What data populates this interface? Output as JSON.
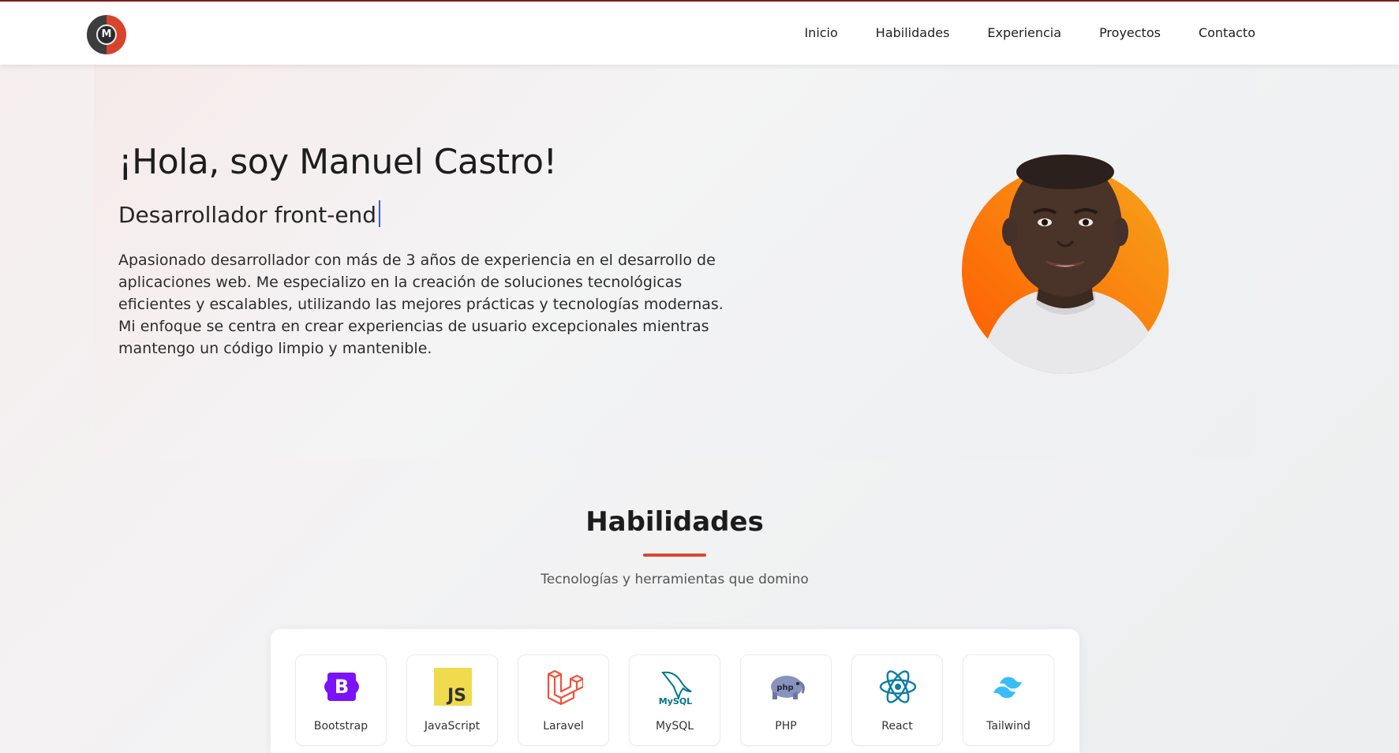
{
  "header": {
    "logo_text": "M",
    "nav": [
      {
        "label": "Inicio"
      },
      {
        "label": "Habilidades"
      },
      {
        "label": "Experiencia"
      },
      {
        "label": "Proyectos"
      },
      {
        "label": "Contacto"
      }
    ]
  },
  "hero": {
    "title": "¡Hola, soy Manuel Castro!",
    "subtitle": "Desarrollador front-end",
    "description": "Apasionado desarrollador con más de 3 años de experiencia en el desarrollo de aplicaciones web. Me especializo en la creación de soluciones tecnológicas eficientes y escalables, utilizando las mejores prácticas y tecnologías modernas. Mi enfoque se centra en crear experiencias de usuario excepcionales mientras mantengo un código limpio y mantenible."
  },
  "skills": {
    "title": "Habilidades",
    "subtitle": "Tecnologías y herramientas que domino",
    "items": [
      {
        "label": "Bootstrap",
        "icon": "bootstrap-icon",
        "icon_text": "B"
      },
      {
        "label": "JavaScript",
        "icon": "javascript-icon",
        "icon_text": "JS"
      },
      {
        "label": "Laravel",
        "icon": "laravel-icon"
      },
      {
        "label": "MySQL",
        "icon": "mysql-icon",
        "icon_text": "MySQL"
      },
      {
        "label": "PHP",
        "icon": "php-icon",
        "icon_text": "php"
      },
      {
        "label": "React",
        "icon": "react-icon"
      },
      {
        "label": "Tailwind",
        "icon": "tailwind-icon"
      }
    ]
  },
  "colors": {
    "accent": "#d9482f",
    "header_border": "#7a1d1d",
    "avatar_gradient_start": "#ff5a00",
    "avatar_gradient_end": "#f6a41b"
  }
}
